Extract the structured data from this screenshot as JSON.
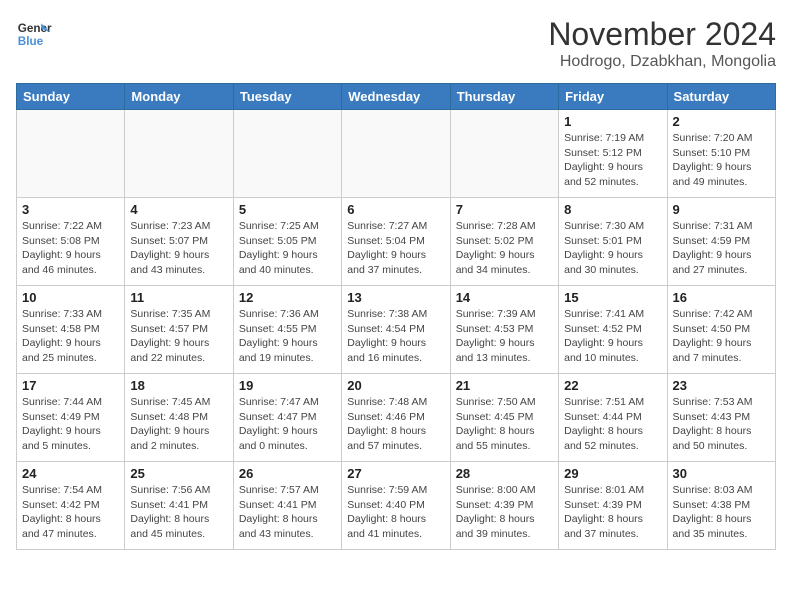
{
  "logo": {
    "line1": "General",
    "line2": "Blue"
  },
  "title": "November 2024",
  "location": "Hodrogo, Dzabkhan, Mongolia",
  "days_of_week": [
    "Sunday",
    "Monday",
    "Tuesday",
    "Wednesday",
    "Thursday",
    "Friday",
    "Saturday"
  ],
  "weeks": [
    [
      {
        "day": "",
        "info": ""
      },
      {
        "day": "",
        "info": ""
      },
      {
        "day": "",
        "info": ""
      },
      {
        "day": "",
        "info": ""
      },
      {
        "day": "",
        "info": ""
      },
      {
        "day": "1",
        "info": "Sunrise: 7:19 AM\nSunset: 5:12 PM\nDaylight: 9 hours and 52 minutes."
      },
      {
        "day": "2",
        "info": "Sunrise: 7:20 AM\nSunset: 5:10 PM\nDaylight: 9 hours and 49 minutes."
      }
    ],
    [
      {
        "day": "3",
        "info": "Sunrise: 7:22 AM\nSunset: 5:08 PM\nDaylight: 9 hours and 46 minutes."
      },
      {
        "day": "4",
        "info": "Sunrise: 7:23 AM\nSunset: 5:07 PM\nDaylight: 9 hours and 43 minutes."
      },
      {
        "day": "5",
        "info": "Sunrise: 7:25 AM\nSunset: 5:05 PM\nDaylight: 9 hours and 40 minutes."
      },
      {
        "day": "6",
        "info": "Sunrise: 7:27 AM\nSunset: 5:04 PM\nDaylight: 9 hours and 37 minutes."
      },
      {
        "day": "7",
        "info": "Sunrise: 7:28 AM\nSunset: 5:02 PM\nDaylight: 9 hours and 34 minutes."
      },
      {
        "day": "8",
        "info": "Sunrise: 7:30 AM\nSunset: 5:01 PM\nDaylight: 9 hours and 30 minutes."
      },
      {
        "day": "9",
        "info": "Sunrise: 7:31 AM\nSunset: 4:59 PM\nDaylight: 9 hours and 27 minutes."
      }
    ],
    [
      {
        "day": "10",
        "info": "Sunrise: 7:33 AM\nSunset: 4:58 PM\nDaylight: 9 hours and 25 minutes."
      },
      {
        "day": "11",
        "info": "Sunrise: 7:35 AM\nSunset: 4:57 PM\nDaylight: 9 hours and 22 minutes."
      },
      {
        "day": "12",
        "info": "Sunrise: 7:36 AM\nSunset: 4:55 PM\nDaylight: 9 hours and 19 minutes."
      },
      {
        "day": "13",
        "info": "Sunrise: 7:38 AM\nSunset: 4:54 PM\nDaylight: 9 hours and 16 minutes."
      },
      {
        "day": "14",
        "info": "Sunrise: 7:39 AM\nSunset: 4:53 PM\nDaylight: 9 hours and 13 minutes."
      },
      {
        "day": "15",
        "info": "Sunrise: 7:41 AM\nSunset: 4:52 PM\nDaylight: 9 hours and 10 minutes."
      },
      {
        "day": "16",
        "info": "Sunrise: 7:42 AM\nSunset: 4:50 PM\nDaylight: 9 hours and 7 minutes."
      }
    ],
    [
      {
        "day": "17",
        "info": "Sunrise: 7:44 AM\nSunset: 4:49 PM\nDaylight: 9 hours and 5 minutes."
      },
      {
        "day": "18",
        "info": "Sunrise: 7:45 AM\nSunset: 4:48 PM\nDaylight: 9 hours and 2 minutes."
      },
      {
        "day": "19",
        "info": "Sunrise: 7:47 AM\nSunset: 4:47 PM\nDaylight: 9 hours and 0 minutes."
      },
      {
        "day": "20",
        "info": "Sunrise: 7:48 AM\nSunset: 4:46 PM\nDaylight: 8 hours and 57 minutes."
      },
      {
        "day": "21",
        "info": "Sunrise: 7:50 AM\nSunset: 4:45 PM\nDaylight: 8 hours and 55 minutes."
      },
      {
        "day": "22",
        "info": "Sunrise: 7:51 AM\nSunset: 4:44 PM\nDaylight: 8 hours and 52 minutes."
      },
      {
        "day": "23",
        "info": "Sunrise: 7:53 AM\nSunset: 4:43 PM\nDaylight: 8 hours and 50 minutes."
      }
    ],
    [
      {
        "day": "24",
        "info": "Sunrise: 7:54 AM\nSunset: 4:42 PM\nDaylight: 8 hours and 47 minutes."
      },
      {
        "day": "25",
        "info": "Sunrise: 7:56 AM\nSunset: 4:41 PM\nDaylight: 8 hours and 45 minutes."
      },
      {
        "day": "26",
        "info": "Sunrise: 7:57 AM\nSunset: 4:41 PM\nDaylight: 8 hours and 43 minutes."
      },
      {
        "day": "27",
        "info": "Sunrise: 7:59 AM\nSunset: 4:40 PM\nDaylight: 8 hours and 41 minutes."
      },
      {
        "day": "28",
        "info": "Sunrise: 8:00 AM\nSunset: 4:39 PM\nDaylight: 8 hours and 39 minutes."
      },
      {
        "day": "29",
        "info": "Sunrise: 8:01 AM\nSunset: 4:39 PM\nDaylight: 8 hours and 37 minutes."
      },
      {
        "day": "30",
        "info": "Sunrise: 8:03 AM\nSunset: 4:38 PM\nDaylight: 8 hours and 35 minutes."
      }
    ]
  ]
}
